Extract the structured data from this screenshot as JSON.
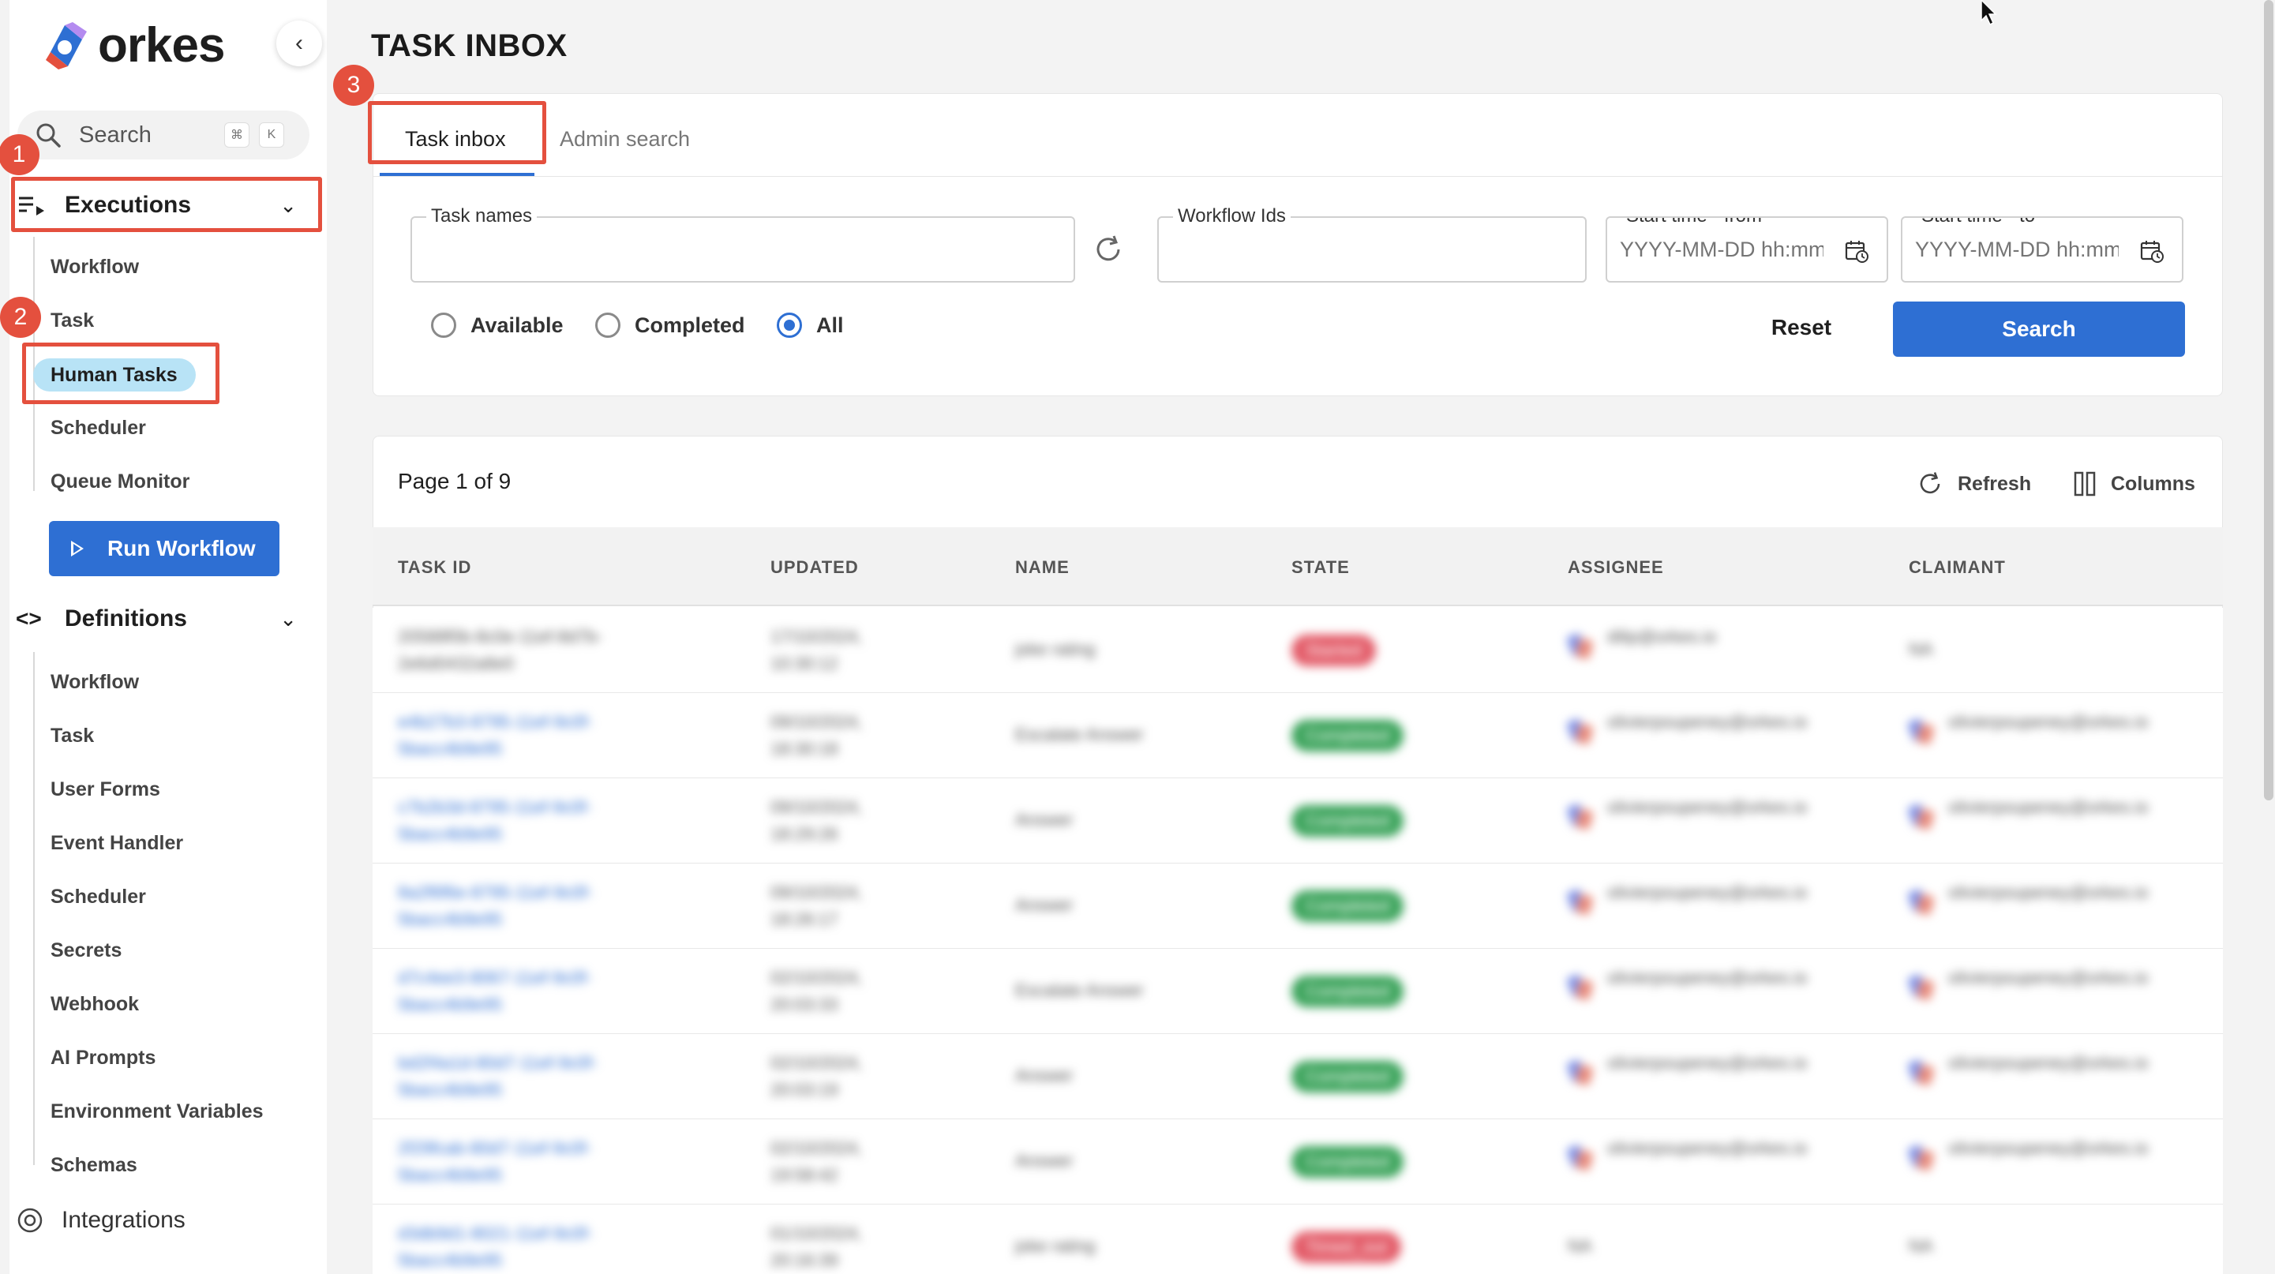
{
  "app": {
    "brand": "orkes"
  },
  "sidebar": {
    "search": {
      "label": "Search",
      "shortcut": [
        "⌘",
        "K"
      ]
    },
    "executions": {
      "label": "Executions",
      "items": [
        "Workflow",
        "Task",
        "Human Tasks",
        "Scheduler",
        "Queue Monitor"
      ],
      "active": "Human Tasks"
    },
    "run_workflow_label": "Run Workflow",
    "definitions": {
      "label": "Definitions",
      "items": [
        "Workflow",
        "Task",
        "User Forms",
        "Event Handler",
        "Scheduler",
        "Secrets",
        "Webhook",
        "AI Prompts",
        "Environment Variables",
        "Schemas"
      ]
    },
    "integrations_label": "Integrations"
  },
  "annotations": [
    "1",
    "2",
    "3"
  ],
  "page": {
    "title": "TASK INBOX"
  },
  "tabs": [
    {
      "label": "Task inbox",
      "active": true
    },
    {
      "label": "Admin search",
      "active": false
    }
  ],
  "filters": {
    "task_names": {
      "label": "Task names",
      "value": ""
    },
    "workflow_ids": {
      "label": "Workflow Ids",
      "value": ""
    },
    "start_from": {
      "label": "Start time - from",
      "placeholder": "YYYY-MM-DD hh:mm"
    },
    "start_to": {
      "label": "Start time - to",
      "placeholder": "YYYY-MM-DD hh:mm"
    },
    "radios": [
      {
        "label": "Available",
        "checked": false
      },
      {
        "label": "Completed",
        "checked": false
      },
      {
        "label": "All",
        "checked": true
      }
    ],
    "reset_label": "Reset",
    "search_label": "Search"
  },
  "results": {
    "page_info": "Page 1 of 9",
    "refresh_label": "Refresh",
    "columns_label": "Columns",
    "headers": [
      "TASK ID",
      "UPDATED",
      "NAME",
      "STATE",
      "ASSIGNEE",
      "CLAIMANT"
    ],
    "rows": [
      {
        "id": "20588f0b-8c0e-11ef-8d7b-2e6d0432a8e0",
        "updated": "17/10/2024, 10:30:12",
        "name": "joke rating",
        "state": "Started",
        "assignee": "dilip@orkes.io",
        "claimant": "NA"
      },
      {
        "id": "e4b27b3-8795-11ef-9c0f-5bacc4b9e95",
        "updated": "09/10/2024, 18:30:18",
        "name": "Escalate Answer",
        "state": "Completed",
        "assignee": "olivierpoupeney@orkes.io",
        "claimant": "olivierpoupeney@orkes.io"
      },
      {
        "id": "c7b2b3d-8795-11ef-9c0f-5bacc4b9e95",
        "updated": "09/10/2024, 18:29:26",
        "name": "Answer",
        "state": "Completed",
        "assignee": "olivierpoupeney@orkes.io",
        "claimant": "olivierpoupeney@orkes.io"
      },
      {
        "id": "8a2f6f6e-8795-11ef-9c0f-5bacc4b9e95",
        "updated": "09/10/2024, 18:26:17",
        "name": "Answer",
        "state": "Completed",
        "assignee": "olivierpoupeney@orkes.io",
        "claimant": "olivierpoupeney@orkes.io"
      },
      {
        "id": "d7c4ee3-8067-11ef-9c0f-5bacc4b9e95",
        "updated": "02/10/2024, 20:03:33",
        "name": "Escalate Answer",
        "state": "Completed",
        "assignee": "olivierpoupeney@orkes.io",
        "claimant": "olivierpoupeney@orkes.io"
      },
      {
        "id": "bd2f4a1d-80d7-11ef-9c0f-5bacc4b9e95",
        "updated": "02/10/2024, 20:03:19",
        "name": "Answer",
        "state": "Completed",
        "assignee": "olivierpoupeney@orkes.io",
        "claimant": "olivierpoupeney@orkes.io"
      },
      {
        "id": "2f29fcab-80d7-11ef-9c0f-5bacc4b9e95",
        "updated": "02/10/2024, 19:58:42",
        "name": "Answer",
        "state": "Completed",
        "assignee": "olivierpoupeney@orkes.io",
        "claimant": "olivierpoupeney@orkes.io"
      },
      {
        "id": "d3db9d1-8021-11ef-9c0f-5bacc4b9e95",
        "updated": "01/10/2024, 20:16:39",
        "name": "joke rating",
        "state": "Timed_out",
        "assignee": "NA",
        "claimant": "NA"
      }
    ]
  },
  "colors": {
    "primary": "#2e6fd3",
    "annotation": "#e4503e",
    "active_pill": "#b8e3f6",
    "completed": "#3aa35a",
    "failed": "#e35b68"
  }
}
